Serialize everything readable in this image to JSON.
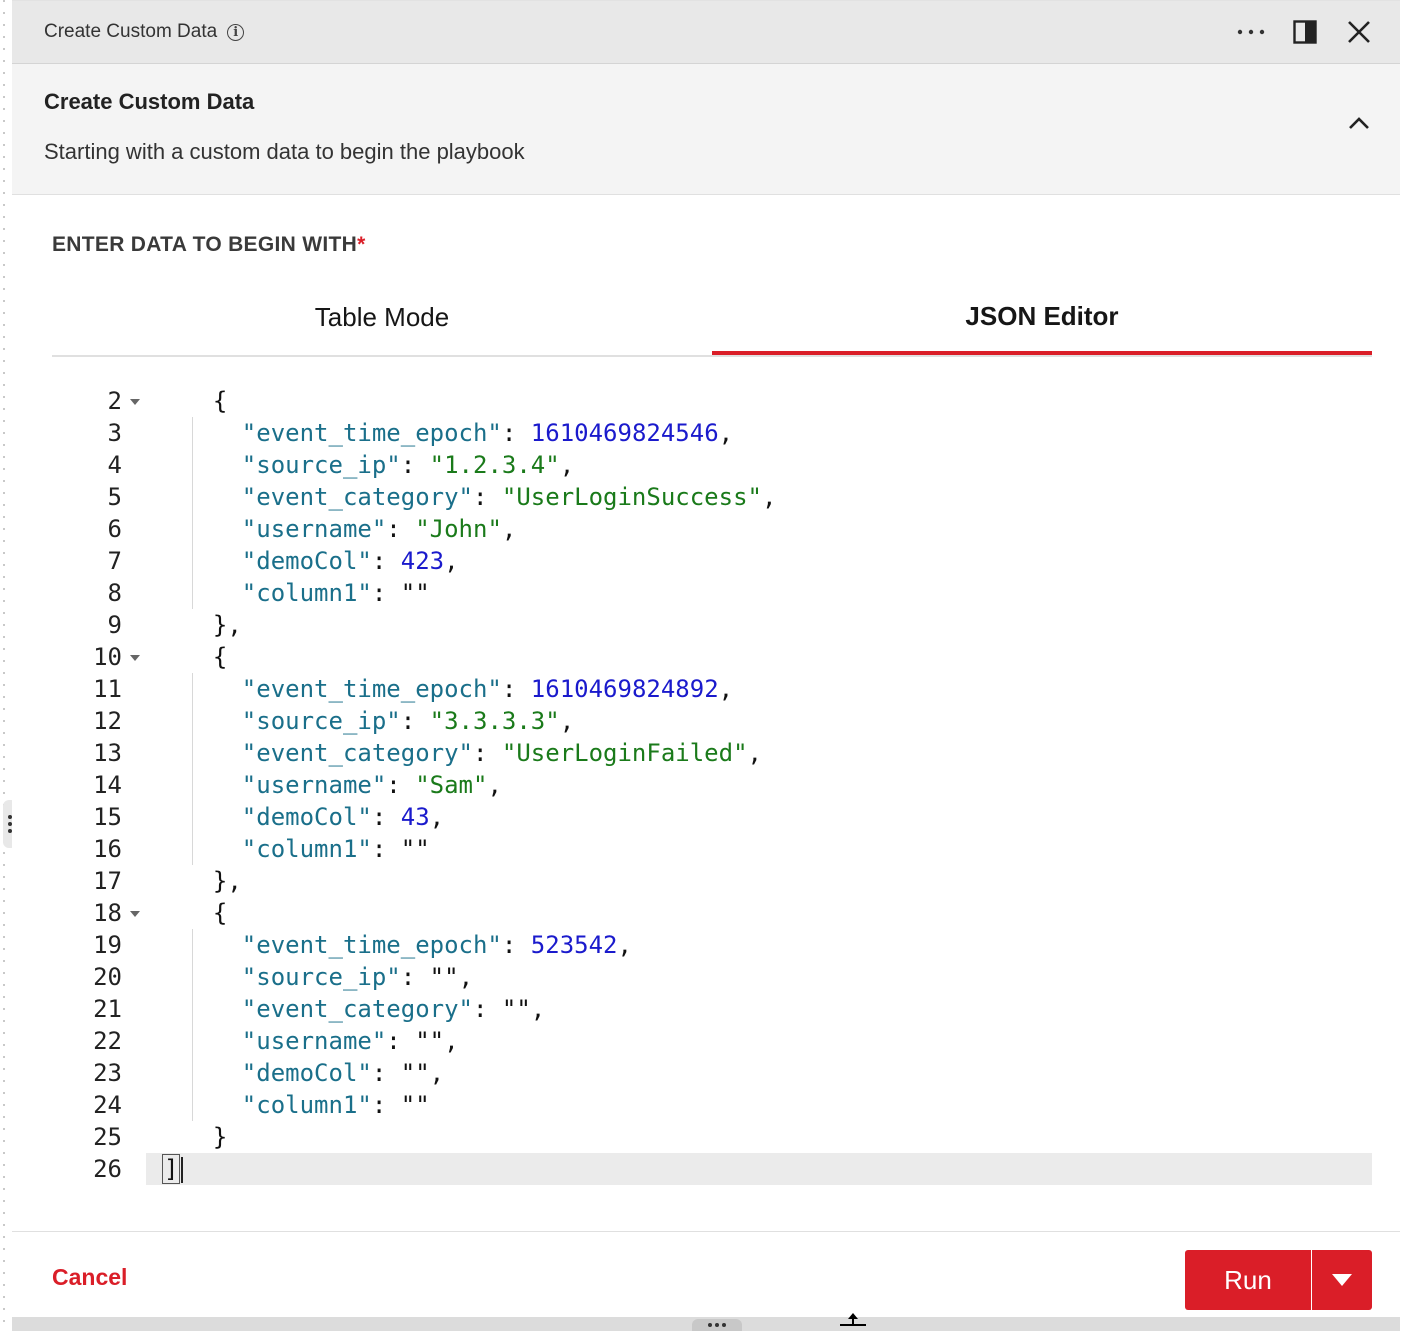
{
  "window": {
    "title": "Create Custom Data",
    "icons": [
      "info-icon",
      "more-icon",
      "split-view-icon",
      "close-icon"
    ]
  },
  "header": {
    "title": "Create Custom Data",
    "subtitle": "Starting with a custom data to begin the playbook",
    "collapse_icon": "chevron-up-icon"
  },
  "form": {
    "section_label": "ENTER DATA TO BEGIN WITH",
    "required_mark": "*",
    "tabs": [
      {
        "label": "Table Mode",
        "selected": false
      },
      {
        "label": "JSON Editor",
        "selected": true
      }
    ]
  },
  "editor": {
    "lines": [
      {
        "num": "2",
        "fold": true
      },
      {
        "num": "3"
      },
      {
        "num": "4"
      },
      {
        "num": "5"
      },
      {
        "num": "6"
      },
      {
        "num": "7"
      },
      {
        "num": "8"
      },
      {
        "num": "9"
      },
      {
        "num": "10",
        "fold": true
      },
      {
        "num": "11"
      },
      {
        "num": "12"
      },
      {
        "num": "13"
      },
      {
        "num": "14"
      },
      {
        "num": "15"
      },
      {
        "num": "16"
      },
      {
        "num": "17"
      },
      {
        "num": "18",
        "fold": true
      },
      {
        "num": "19"
      },
      {
        "num": "20"
      },
      {
        "num": "21"
      },
      {
        "num": "22"
      },
      {
        "num": "23"
      },
      {
        "num": "24"
      },
      {
        "num": "25"
      },
      {
        "num": "26"
      }
    ],
    "records": [
      {
        "event_time_epoch": "1610469824546",
        "source_ip": "\"1.2.3.4\"",
        "event_category": "\"UserLoginSuccess\"",
        "username": "\"John\"",
        "demoCol": "423",
        "column1": "\"\""
      },
      {
        "event_time_epoch": "1610469824892",
        "source_ip": "\"3.3.3.3\"",
        "event_category": "\"UserLoginFailed\"",
        "username": "\"Sam\"",
        "demoCol": "43",
        "column1": "\"\""
      },
      {
        "event_time_epoch": "523542",
        "source_ip": "\"\"",
        "event_category": "\"\"",
        "username": "\"\"",
        "demoCol": "\"\"",
        "column1": "\"\""
      }
    ],
    "keys": {
      "event_time_epoch": "\"event_time_epoch\"",
      "source_ip": "\"source_ip\"",
      "event_category": "\"event_category\"",
      "username": "\"username\"",
      "demoCol": "\"demoCol\"",
      "column1": "\"column1\""
    }
  },
  "footer": {
    "cancel_label": "Cancel",
    "run_label": "Run",
    "run_menu_icon": "caret-down-icon"
  },
  "colors": {
    "accent": "#da1e28",
    "json_key": "#1a6f8a",
    "json_string": "#1a7a1a",
    "json_number": "#1a1acc"
  }
}
